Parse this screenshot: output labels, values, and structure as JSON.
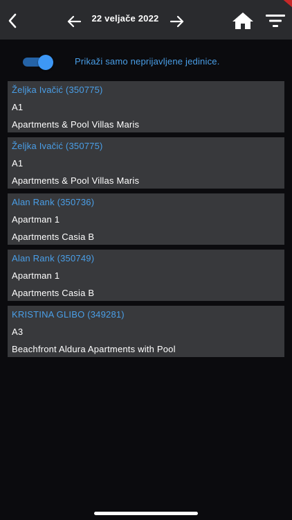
{
  "header": {
    "date": "22 veljače 2022",
    "icons": {
      "back": "back-chevron-icon",
      "prev": "arrow-left-icon",
      "next": "arrow-right-icon",
      "home": "home-icon",
      "filter": "filter-icon"
    }
  },
  "toggle": {
    "label": "Prikaži samo neprijavljene jedinice.",
    "on": true,
    "color": "#3d97f5"
  },
  "colors": {
    "accent": "#4a9fe8",
    "card": "#38393c",
    "header": "#2a2b2e",
    "background": "#0b0b0e"
  },
  "items": [
    {
      "guest": "Željka Ivačić (350775)",
      "unit": "A1",
      "property": "Apartments & Pool Villas Maris"
    },
    {
      "guest": "Željka Ivačić (350775)",
      "unit": "A1",
      "property": "Apartments & Pool Villas Maris"
    },
    {
      "guest": "Alan Rank (350736)",
      "unit": "Apartman 1",
      "property": "Apartments Casia B"
    },
    {
      "guest": "Alan Rank (350749)",
      "unit": "Apartman 1",
      "property": "Apartments Casia B"
    },
    {
      "guest": "KRISTINA GLIBO (349281)",
      "unit": "A3",
      "property": "Beachfront Aldura Apartments with Pool"
    }
  ]
}
